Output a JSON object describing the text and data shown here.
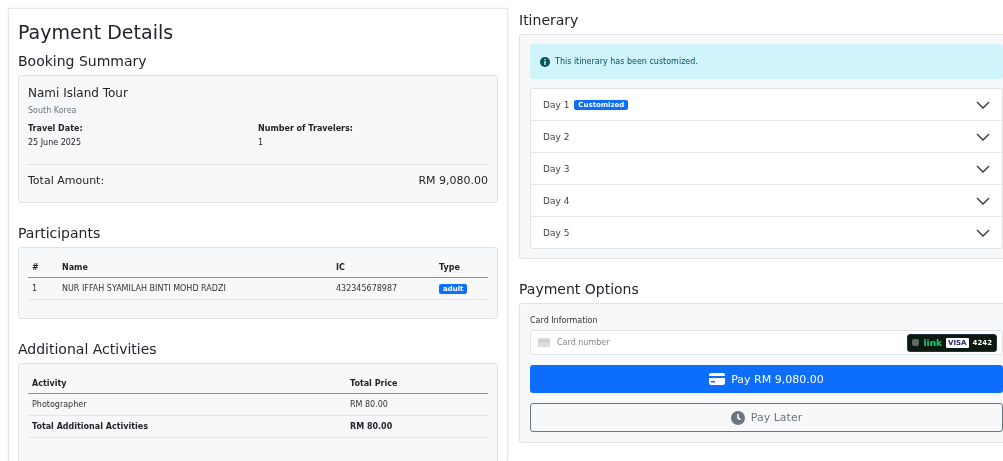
{
  "payment_details": {
    "title": "Payment Details",
    "booking_summary": {
      "heading": "Booking Summary",
      "tour": "Nami Island Tour",
      "country": "South Korea",
      "fields": [
        {
          "label": "Travel Date:",
          "value": "25 June 2025"
        },
        {
          "label": "Number of Travelers:",
          "value": "1"
        }
      ],
      "total_label": "Total Amount:",
      "total_value": "RM 9,080.00"
    },
    "participants": {
      "heading": "Participants",
      "columns": [
        "#",
        "Name",
        "IC",
        "Type"
      ],
      "rows": [
        {
          "cells": [
            "1",
            "NUR IFFAH SYAMILAH BINTI MOHD RADZI",
            "432345678987"
          ],
          "type": "adult"
        }
      ]
    },
    "additional_activities": {
      "heading": "Additional Activities",
      "columns": [
        "Activity",
        "Total Price"
      ],
      "rows": [
        {
          "kind": "item",
          "cells": [
            "Photographer",
            "RM 80.00"
          ]
        },
        {
          "kind": "total",
          "cells": [
            "Total Additional Activities",
            "RM 80.00"
          ]
        }
      ]
    }
  },
  "itinerary": {
    "heading": "Itinerary",
    "alert": "This itinerary has been customized.",
    "days": [
      {
        "label": "Day 1",
        "badge": "Customized",
        "expanded": false
      },
      {
        "label": "Day 2",
        "expanded": false
      },
      {
        "label": "Day 3",
        "expanded": false
      },
      {
        "label": "Day 4",
        "expanded": false
      },
      {
        "label": "Day 5",
        "expanded": false
      }
    ]
  },
  "payment_options": {
    "heading": "Payment Options",
    "card_label": "Card Information",
    "card_placeholder": "Card number",
    "link_badge": {
      "brand": "link",
      "card_brand": "VISA",
      "last4": "4242"
    },
    "buttons": [
      {
        "kind": "primary",
        "label": "Pay RM 9,080.00"
      },
      {
        "kind": "outline",
        "label": "Pay Later"
      }
    ]
  }
}
